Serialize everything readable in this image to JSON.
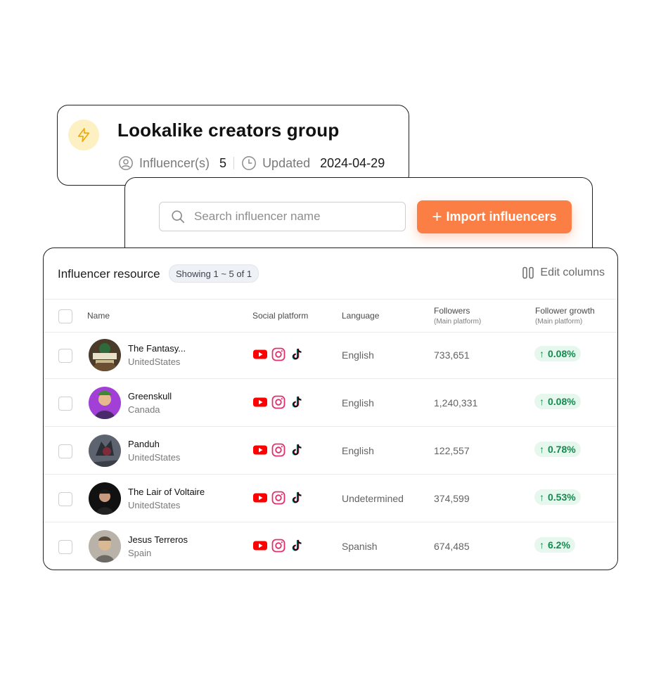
{
  "group": {
    "title": "Lookalike creators group",
    "influencers_label": "Influencer(s)",
    "influencers_count": "5",
    "updated_label": "Updated",
    "updated_date": "2024-04-29"
  },
  "search": {
    "placeholder": "Search influencer name",
    "import_label": "Import influencers",
    "import_icon": "+"
  },
  "table": {
    "title": "Influencer resource",
    "showing": "Showing 1 ~ 5 of 1",
    "edit_columns_label": "Edit columns",
    "columns": {
      "name": "Name",
      "platform": "Social platform",
      "language": "Language",
      "followers": "Followers",
      "followers_sub": "(Main platform)",
      "growth": "Follower growth",
      "growth_sub": "(Main platform)"
    },
    "rows": [
      {
        "name": "The Fantasy...",
        "country": "UnitedStates",
        "language": "English",
        "followers": "733,651",
        "growth": "0.08%"
      },
      {
        "name": "Greenskull",
        "country": "Canada",
        "language": "English",
        "followers": "1,240,331",
        "growth": "0.08%"
      },
      {
        "name": "Panduh",
        "country": "UnitedStates",
        "language": "English",
        "followers": "122,557",
        "growth": "0.78%"
      },
      {
        "name": "The Lair of Voltaire",
        "country": "UnitedStates",
        "language": "Undetermined",
        "followers": "374,599",
        "growth": "0.53%"
      },
      {
        "name": "Jesus Terreros",
        "country": "Spain",
        "language": "Spanish",
        "followers": "674,485",
        "growth": "6.2%"
      }
    ],
    "platform_icons": [
      "youtube-icon",
      "instagram-icon",
      "tiktok-icon"
    ]
  },
  "colors": {
    "accent": "#fb7f44",
    "growth_text": "#138a4f",
    "growth_bg": "#e6f7ee",
    "bolt_bg": "#fdf0c2",
    "youtube": "#ff0000"
  }
}
